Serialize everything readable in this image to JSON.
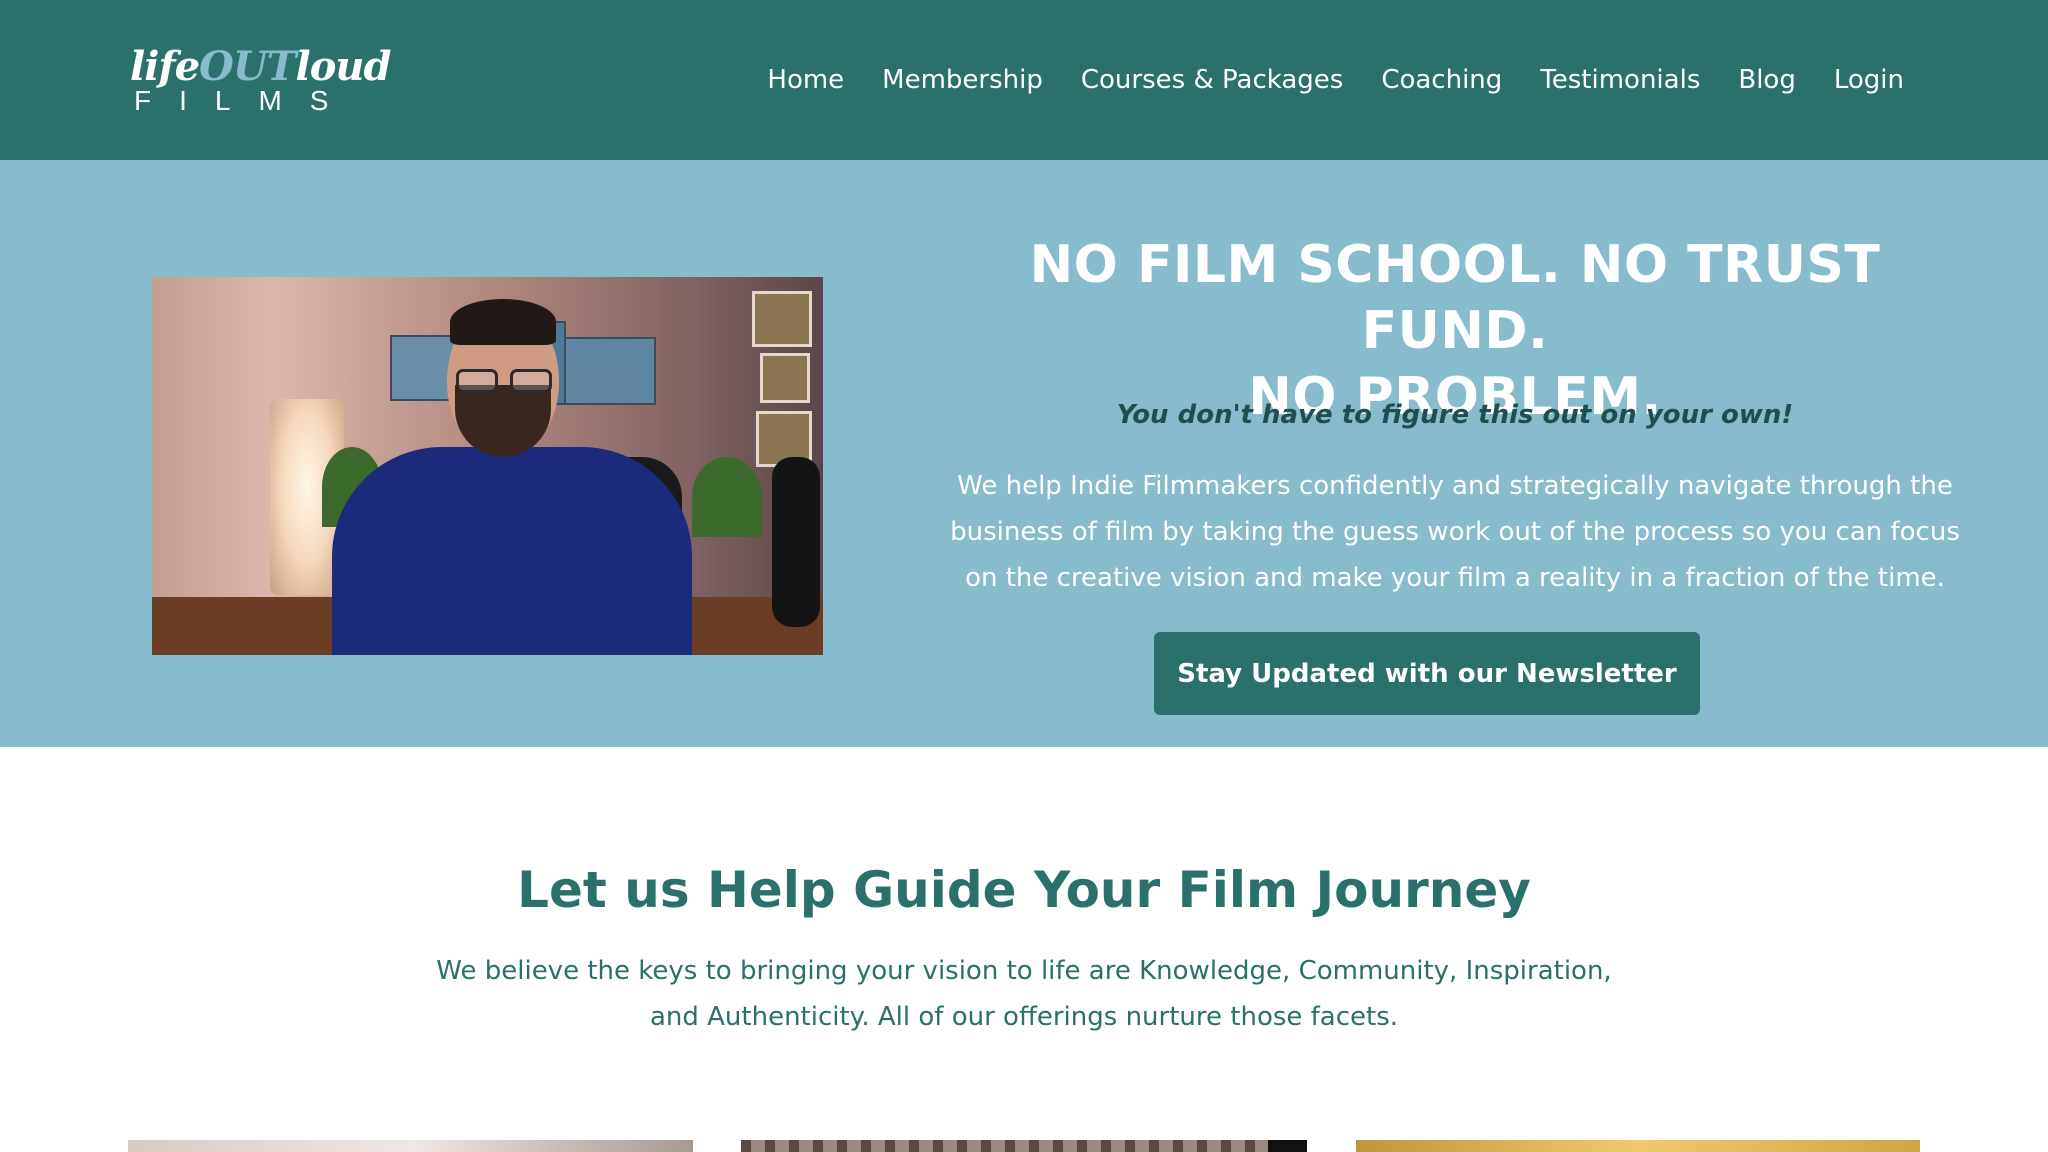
{
  "header": {
    "logo": {
      "script_prefix": "life",
      "script_highlight": "OUT",
      "script_suffix": "loud",
      "subtitle": "FILMS"
    },
    "nav": [
      {
        "label": "Home"
      },
      {
        "label": "Membership"
      },
      {
        "label": "Courses & Packages"
      },
      {
        "label": "Coaching"
      },
      {
        "label": "Testimonials"
      },
      {
        "label": "Blog"
      },
      {
        "label": "Login"
      }
    ]
  },
  "hero": {
    "title_line1": "NO FILM SCHOOL. NO TRUST FUND.",
    "title_line2": "NO PROBLEM.",
    "subtitle": "You don't have to figure this out on your own!",
    "body": "We help Indie Filmmakers confidently and strategically navigate through the business of film by taking the guess work out of the process so you can focus on the creative vision and make your film a reality in a fraction of the time.",
    "cta_label": "Stay Updated with our Newsletter"
  },
  "section": {
    "title": "Let us Help Guide Your Film Journey",
    "body": "We believe the keys to bringing your vision to life are Knowledge, Community, Inspiration, and Authenticity. All of our offerings nurture those facets."
  },
  "colors": {
    "header_bg": "#2b716b",
    "hero_bg": "#86bccb",
    "accent": "#2b716b",
    "logo_highlight": "#86bccb",
    "subtitle_text": "#1f4f4c"
  }
}
